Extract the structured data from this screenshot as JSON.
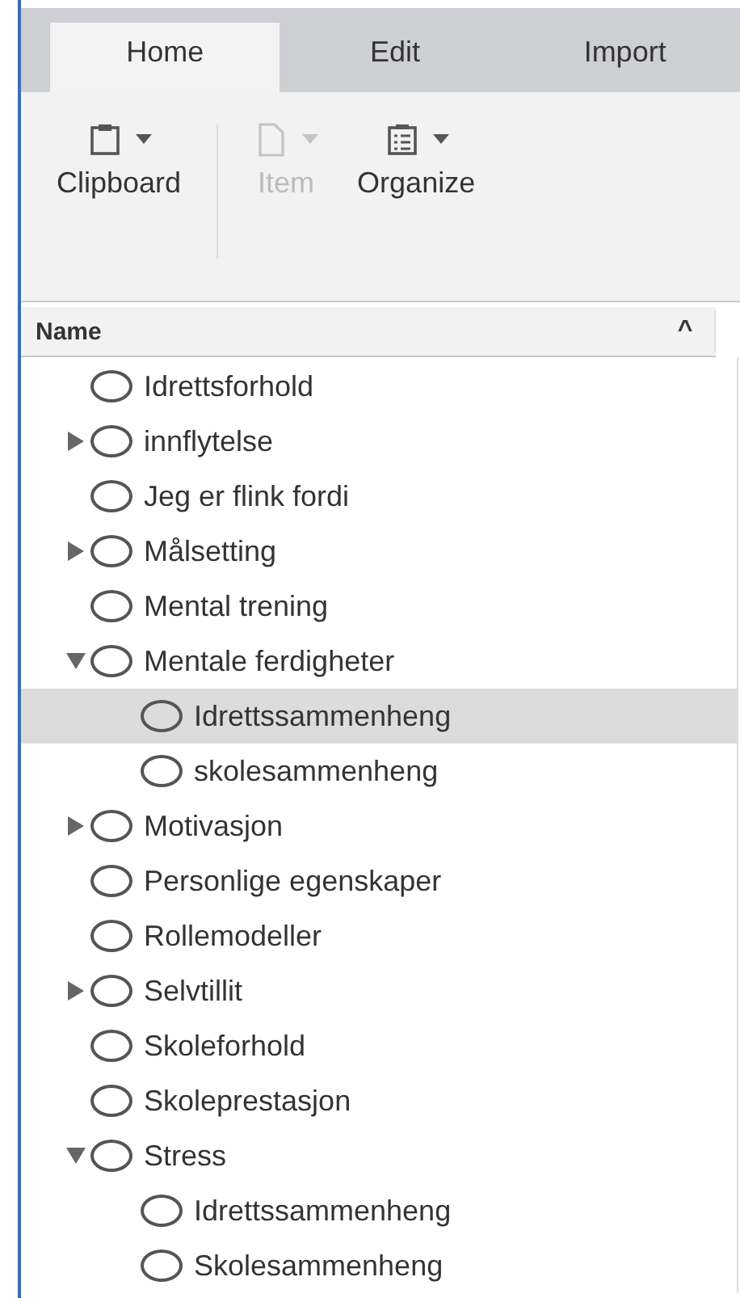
{
  "tabs": [
    {
      "label": "Home",
      "selected": true
    },
    {
      "label": "Edit",
      "selected": false
    },
    {
      "label": "Import",
      "selected": false
    }
  ],
  "ribbon": [
    {
      "label": "Clipboard",
      "kind": "clipboard",
      "disabled": false
    },
    {
      "label": "Item",
      "kind": "document",
      "disabled": true
    },
    {
      "label": "Organize",
      "kind": "list",
      "disabled": false
    }
  ],
  "tree": {
    "column": "Name",
    "sort_indicator": "^",
    "items": [
      {
        "label": "Idrettsforhold",
        "selected": false
      },
      {
        "label": "innflytelse",
        "expanded": false,
        "selected": false
      },
      {
        "label": "Jeg er flink fordi",
        "selected": false
      },
      {
        "label": "Målsetting",
        "expanded": false,
        "selected": false
      },
      {
        "label": "Mental trening",
        "selected": false
      },
      {
        "label": "Mentale ferdigheter",
        "expanded": true,
        "selected": false,
        "children": [
          {
            "label": "Idrettssammenheng",
            "selected": true
          },
          {
            "label": "skolesammenheng",
            "selected": false
          }
        ]
      },
      {
        "label": "Motivasjon",
        "expanded": false,
        "selected": false
      },
      {
        "label": "Personlige egenskaper",
        "selected": false
      },
      {
        "label": "Rollemodeller",
        "selected": false
      },
      {
        "label": "Selvtillit",
        "expanded": false,
        "selected": false
      },
      {
        "label": "Skoleforhold",
        "selected": false
      },
      {
        "label": "Skoleprestasjon",
        "selected": false
      },
      {
        "label": "Stress",
        "expanded": true,
        "selected": false,
        "children": [
          {
            "label": "Idrettssammenheng",
            "selected": false
          },
          {
            "label": "Skolesammenheng",
            "selected": false
          }
        ]
      }
    ]
  }
}
